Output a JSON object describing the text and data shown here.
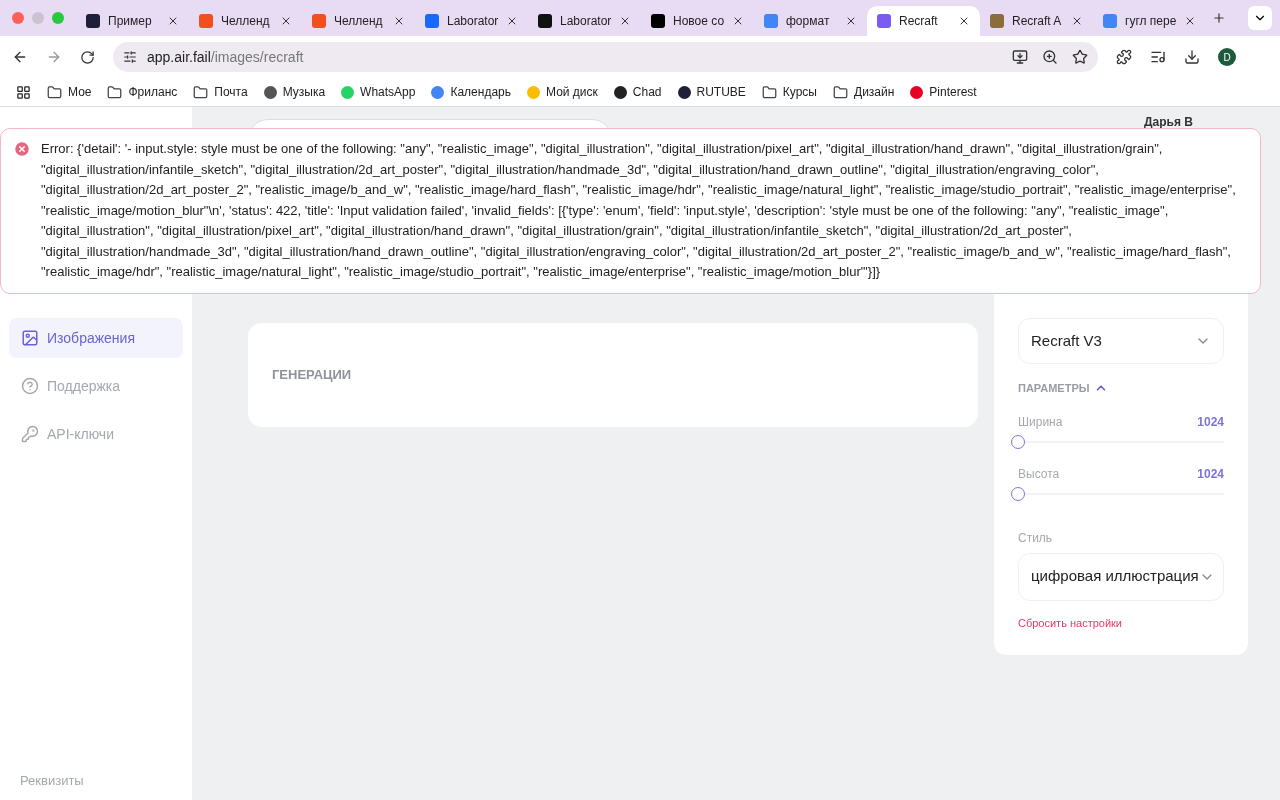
{
  "browser": {
    "tabs": [
      {
        "label": "Пример",
        "selected": false,
        "color": "#1f1f3a"
      },
      {
        "label": "Челленд",
        "selected": false,
        "color": "#f24e1e"
      },
      {
        "label": "Челленд",
        "selected": false,
        "color": "#f24e1e"
      },
      {
        "label": "Laborator",
        "selected": false,
        "color": "#1769ff"
      },
      {
        "label": "Laborator",
        "selected": false,
        "color": "#111111"
      },
      {
        "label": "Новое со",
        "selected": false,
        "color": "#000000"
      },
      {
        "label": "формат",
        "selected": false,
        "color": "#4285f4"
      },
      {
        "label": "Recraft",
        "selected": true,
        "color": "#7b5cf0"
      },
      {
        "label": "Recraft A",
        "selected": false,
        "color": "#8a6d3b"
      },
      {
        "label": "гугл пере",
        "selected": false,
        "color": "#4285f4"
      }
    ],
    "address": {
      "host": "app.air.fail",
      "path": "/images/recraft"
    },
    "profile": "D",
    "bookmarks": [
      {
        "label": "Мое",
        "kind": "folder"
      },
      {
        "label": "Фриланс",
        "kind": "folder"
      },
      {
        "label": "Почта",
        "kind": "folder"
      },
      {
        "label": "Музыка",
        "kind": "site",
        "color": "#555555"
      },
      {
        "label": "WhatsApp",
        "kind": "site",
        "color": "#25d366"
      },
      {
        "label": "Календарь",
        "kind": "site",
        "color": "#4285f4"
      },
      {
        "label": "Мой диск",
        "kind": "site",
        "color": "#fbbc04"
      },
      {
        "label": "Chad",
        "kind": "site",
        "color": "#222222"
      },
      {
        "label": "RUTUBE",
        "kind": "site",
        "color": "#1f1f3a"
      },
      {
        "label": "Курсы",
        "kind": "folder"
      },
      {
        "label": "Дизайн",
        "kind": "folder"
      },
      {
        "label": "Pinterest",
        "kind": "site",
        "color": "#e60023"
      }
    ]
  },
  "user": {
    "name": "Дарья В"
  },
  "error": "Error: {'detail': '- input.style: style must be one of the following: \"any\", \"realistic_image\", \"digital_illustration\", \"digital_illustration/pixel_art\", \"digital_illustration/hand_drawn\", \"digital_illustration/grain\", \"digital_illustration/infantile_sketch\", \"digital_illustration/2d_art_poster\", \"digital_illustration/handmade_3d\", \"digital_illustration/hand_drawn_outline\", \"digital_illustration/engraving_color\", \"digital_illustration/2d_art_poster_2\", \"realistic_image/b_and_w\", \"realistic_image/hard_flash\", \"realistic_image/hdr\", \"realistic_image/natural_light\", \"realistic_image/studio_portrait\", \"realistic_image/enterprise\", \"realistic_image/motion_blur\"\\n', 'status': 422, 'title': 'Input validation failed', 'invalid_fields': [{'type': 'enum', 'field': 'input.style', 'description': 'style must be one of the following: \"any\", \"realistic_image\", \"digital_illustration\", \"digital_illustration/pixel_art\", \"digital_illustration/hand_drawn\", \"digital_illustration/grain\", \"digital_illustration/infantile_sketch\", \"digital_illustration/2d_art_poster\", \"digital_illustration/handmade_3d\", \"digital_illustration/hand_drawn_outline\", \"digital_illustration/engraving_color\", \"digital_illustration/2d_art_poster_2\", \"realistic_image/b_and_w\", \"realistic_image/hard_flash\", \"realistic_image/hdr\", \"realistic_image/natural_light\", \"realistic_image/studio_portrait\", \"realistic_image/enterprise\", \"realistic_image/motion_blur\"'}]}",
  "sidebar": {
    "items": [
      {
        "label": "Изображения",
        "kind": "image",
        "selected": true
      },
      {
        "label": "Поддержка",
        "kind": "help",
        "selected": false
      },
      {
        "label": "API-ключи",
        "kind": "key",
        "selected": false
      }
    ],
    "footer": "Реквизиты"
  },
  "generations": {
    "title": "ГЕНЕРАЦИИ"
  },
  "settings": {
    "model": "Recraft V3",
    "section": {
      "title": "ПАРАМЕТРЫ",
      "expanded": true
    },
    "sliders": [
      {
        "label": "Ширина",
        "reading": "1024",
        "level": 0
      },
      {
        "label": "Высота",
        "reading": "1024",
        "level": 0
      }
    ],
    "style_label": "Стиль",
    "style": "цифровая иллюстрация",
    "reset": "Сбросить настройки"
  }
}
